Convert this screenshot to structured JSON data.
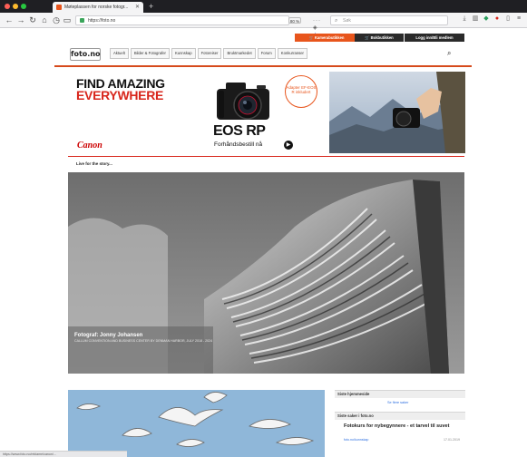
{
  "browser": {
    "tab_title": "Møteplassen for norske fotogr...",
    "tab_close": "✕",
    "new_tab": "+",
    "url": "https://foto.no",
    "zoom": "80 %",
    "url_actions": "···",
    "search_placeholder": "Søk",
    "status_text": "https://www.foto.no/reklame/canon/..."
  },
  "site": {
    "logo": "foto.no",
    "promos": {
      "camera_store": "🛒 Kamerabutikken",
      "bookstore": "🛒 Bokbutikken",
      "login": "Logg inn/Bli medlem"
    },
    "menu": [
      "Aktuelt",
      "Bilder & Fotografer",
      "Kunnskap",
      "Fotoreiser",
      "Bruktmarkedet",
      "Forum",
      "Konkurranser"
    ]
  },
  "ad": {
    "headline_line1": "FIND AMAZING",
    "headline_line2": "EVERYWHERE",
    "brand": "Canon",
    "badge": "Adapter EF-EOS R inkludert",
    "product": "EOS RP",
    "cta": "Forhåndsbestill nå",
    "subline": "Live for the story..."
  },
  "hero": {
    "caption": "Fotograf: Jonny Johansen",
    "credit": "CALLUM CONVENTION AND BUSINESS CENTER BY DENMAN HARBOR, JULY 2018 - 2024"
  },
  "sidebar": {
    "box1_title": "Siste hjemmeside",
    "box1_link": "Se flere saker",
    "box2_title": "Siste saker i foto.no",
    "article_title": "Fotokurs for nybegynnere - et tarvel til suvet",
    "article_meta_left": "foto.no/kunnskap",
    "article_meta_right": "17.01.2019"
  },
  "colors": {
    "accent": "#e8551c",
    "canon_red": "#cc0000",
    "rule": "#d64a1c"
  }
}
